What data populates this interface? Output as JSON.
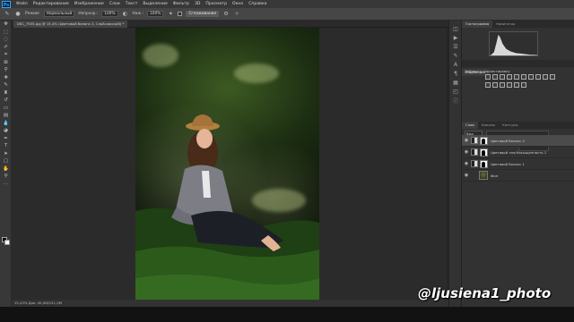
{
  "app": {
    "logo": "Ps"
  },
  "menu": [
    "Файл",
    "Редактирование",
    "Изображение",
    "Слои",
    "Текст",
    "Выделение",
    "Фильтр",
    "3D",
    "Просмотр",
    "Окно",
    "Справка"
  ],
  "options": {
    "mode_label": "Режим:",
    "mode_value": "Нормальный",
    "opacity_label": "Непрозр.:",
    "opacity_value": "100%",
    "flow_label": "Наж.:",
    "flow_value": "100%",
    "sample_label": "Сглаживание"
  },
  "document": {
    "tab_title": "DSC_7935.jpg @ 15,4% (Цветовой баланс 2, Слой-маска/8) *",
    "status": "15,43%        Док: 45,0M/151,0M"
  },
  "panels": {
    "top_tabs": [
      "Гистограмма",
      "Навигатор"
    ],
    "adjustments_tab": "Коррекция",
    "adjustments_subtitle": "Добавить корректировку",
    "layers_tabs": [
      "Слои",
      "Каналы",
      "Контуры"
    ],
    "kind_label": "Вид"
  },
  "layers": [
    {
      "name": "Цветовой баланс 2",
      "selected": true,
      "type": "adjustment"
    },
    {
      "name": "Цветовой тон/Насыщенность 1",
      "selected": false,
      "type": "adjustment"
    },
    {
      "name": "Цветовой баланс 1",
      "selected": false,
      "type": "adjustment"
    },
    {
      "name": "Фон",
      "selected": false,
      "type": "image"
    }
  ],
  "watermark": "@ljusiena1_photo",
  "colors": {
    "accent": "#31a8ff",
    "panel_bg": "#323232",
    "canvas_bg": "#2b2b2b"
  }
}
